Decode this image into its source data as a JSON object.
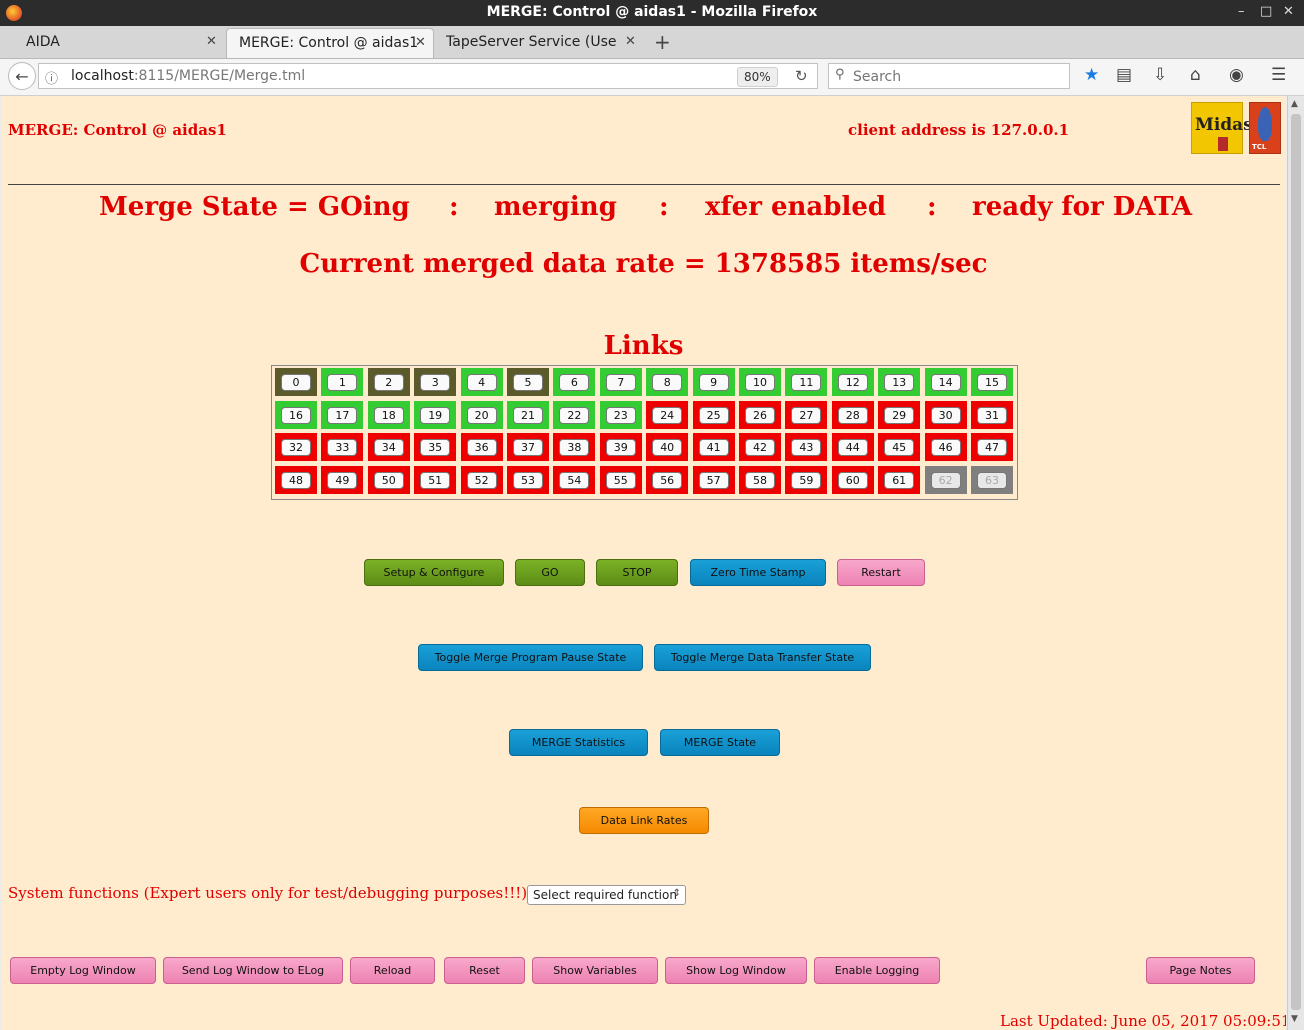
{
  "window": {
    "title": "MERGE: Control @ aidas1 - Mozilla Firefox",
    "minimize": "–",
    "maximize": "□",
    "close": "✕"
  },
  "tabs": [
    {
      "label": "AIDA"
    },
    {
      "label": "MERGE: Control @ aidas1"
    },
    {
      "label": "TapeServer Service (Use..."
    }
  ],
  "tab_close": "✕",
  "new_tab": "+",
  "navbar": {
    "url_host": "localhost",
    "url_path": ":8115/MERGE/Merge.tml",
    "zoom": "80%",
    "search_placeholder": "Search"
  },
  "page": {
    "title": "MERGE: Control @ aidas1",
    "client_address": "client address is 127.0.0.1",
    "logo_text": "Midas",
    "tcl_text": "TCL",
    "state": {
      "merge_state": "Merge State = GOing",
      "sep1": ":",
      "merging": "merging",
      "sep2": ":",
      "xfer": "xfer enabled",
      "sep3": ":",
      "ready": "ready for DATA"
    },
    "rate": "Current merged data rate = 1378585 items/sec",
    "links_title": "Links",
    "links": [
      {
        "n": "0",
        "status": "dark"
      },
      {
        "n": "1",
        "status": "green"
      },
      {
        "n": "2",
        "status": "dark"
      },
      {
        "n": "3",
        "status": "dark"
      },
      {
        "n": "4",
        "status": "green"
      },
      {
        "n": "5",
        "status": "dark"
      },
      {
        "n": "6",
        "status": "green"
      },
      {
        "n": "7",
        "status": "green"
      },
      {
        "n": "8",
        "status": "green"
      },
      {
        "n": "9",
        "status": "green"
      },
      {
        "n": "10",
        "status": "green"
      },
      {
        "n": "11",
        "status": "green"
      },
      {
        "n": "12",
        "status": "green"
      },
      {
        "n": "13",
        "status": "green"
      },
      {
        "n": "14",
        "status": "green"
      },
      {
        "n": "15",
        "status": "green"
      },
      {
        "n": "16",
        "status": "green"
      },
      {
        "n": "17",
        "status": "green"
      },
      {
        "n": "18",
        "status": "green"
      },
      {
        "n": "19",
        "status": "green"
      },
      {
        "n": "20",
        "status": "green"
      },
      {
        "n": "21",
        "status": "green"
      },
      {
        "n": "22",
        "status": "green"
      },
      {
        "n": "23",
        "status": "green"
      },
      {
        "n": "24",
        "status": "red"
      },
      {
        "n": "25",
        "status": "red"
      },
      {
        "n": "26",
        "status": "red"
      },
      {
        "n": "27",
        "status": "red"
      },
      {
        "n": "28",
        "status": "red"
      },
      {
        "n": "29",
        "status": "red"
      },
      {
        "n": "30",
        "status": "red"
      },
      {
        "n": "31",
        "status": "red"
      },
      {
        "n": "32",
        "status": "red"
      },
      {
        "n": "33",
        "status": "red"
      },
      {
        "n": "34",
        "status": "red"
      },
      {
        "n": "35",
        "status": "red"
      },
      {
        "n": "36",
        "status": "red"
      },
      {
        "n": "37",
        "status": "red"
      },
      {
        "n": "38",
        "status": "red"
      },
      {
        "n": "39",
        "status": "red"
      },
      {
        "n": "40",
        "status": "red"
      },
      {
        "n": "41",
        "status": "red"
      },
      {
        "n": "42",
        "status": "red"
      },
      {
        "n": "43",
        "status": "red"
      },
      {
        "n": "44",
        "status": "red"
      },
      {
        "n": "45",
        "status": "red"
      },
      {
        "n": "46",
        "status": "red"
      },
      {
        "n": "47",
        "status": "red"
      },
      {
        "n": "48",
        "status": "red"
      },
      {
        "n": "49",
        "status": "red"
      },
      {
        "n": "50",
        "status": "red"
      },
      {
        "n": "51",
        "status": "red"
      },
      {
        "n": "52",
        "status": "red"
      },
      {
        "n": "53",
        "status": "red"
      },
      {
        "n": "54",
        "status": "red"
      },
      {
        "n": "55",
        "status": "red"
      },
      {
        "n": "56",
        "status": "red"
      },
      {
        "n": "57",
        "status": "red"
      },
      {
        "n": "58",
        "status": "red"
      },
      {
        "n": "59",
        "status": "red"
      },
      {
        "n": "60",
        "status": "red"
      },
      {
        "n": "61",
        "status": "red"
      },
      {
        "n": "62",
        "status": "grey"
      },
      {
        "n": "63",
        "status": "grey"
      }
    ],
    "buttons": {
      "setup": "Setup & Configure",
      "go": "GO",
      "stop": "STOP",
      "zero": "Zero Time Stamp",
      "restart": "Restart",
      "toggle_pause": "Toggle Merge Program Pause State",
      "toggle_xfer": "Toggle Merge Data Transfer State",
      "statistics": "MERGE Statistics",
      "state": "MERGE State",
      "data_link_rates": "Data Link Rates"
    },
    "system_functions_label": "System functions (Expert users only for test/debugging purposes!!!)",
    "system_select": "Select required function",
    "footer_buttons": {
      "empty_log": "Empty Log Window",
      "send_log": "Send Log Window to ELog",
      "reload": "Reload",
      "reset": "Reset",
      "show_variables": "Show Variables",
      "show_log": "Show Log Window",
      "enable_logging": "Enable Logging",
      "page_notes": "Page Notes"
    },
    "last_updated": "Last Updated: June 05, 2017 05:09:51"
  },
  "colors": {
    "page_bg": "#ffebcd",
    "heading_red": "#e00000",
    "link_green": "#33cc33",
    "link_dark": "#5a5a2a",
    "link_red": "#ee0000",
    "link_grey": "#7f7f7f",
    "button_olive": "#6a9e1e",
    "button_blue": "#0e90c8",
    "button_pink": "#f294bf",
    "button_orange": "#f99a10"
  }
}
